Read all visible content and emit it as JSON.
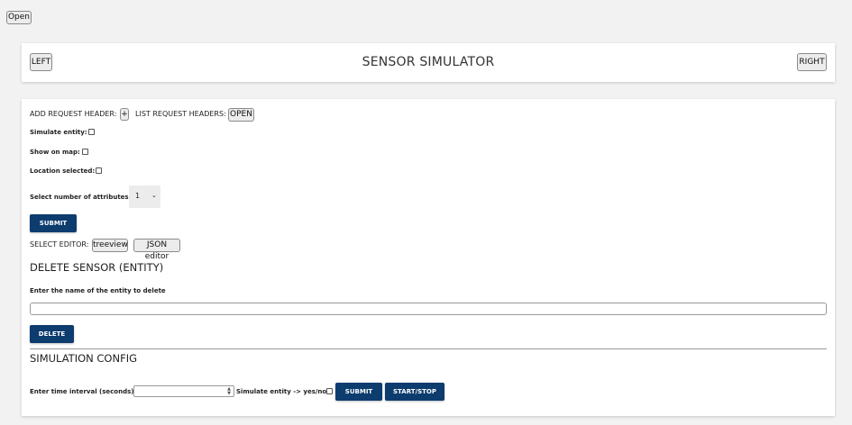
{
  "top": {
    "open_label": "Open"
  },
  "header": {
    "left_label": "LEFT",
    "title": "SENSOR SIMULATOR",
    "right_label": "RIGHT"
  },
  "request_headers": {
    "add_label": "ADD REQUEST HEADER:",
    "add_button": "+",
    "list_label": "LIST REQUEST HEADERS:",
    "list_button": "OPEN"
  },
  "options": {
    "simulate_entity": "Simulate entity:",
    "show_on_map": "Show on map:",
    "location_selected": "Location selected:",
    "attributes_label": "Select number of attributes",
    "attributes_value": "1",
    "submit_label": "SUBMIT"
  },
  "editor": {
    "label": "SELECT EDITOR:",
    "treeview": "treeview",
    "json_editor": "JSON editor"
  },
  "delete": {
    "heading": "DELETE SENSOR (ENTITY)",
    "field_label": "Enter the name of the entity to delete",
    "input_value": "",
    "button": "DELETE"
  },
  "simulation": {
    "heading": "SIMULATION CONFIG",
    "interval_label": "Enter time interval (seconds)",
    "interval_value": "",
    "simulate_label": "Simulate entity -> yes/no",
    "submit_label": "SUBMIT",
    "start_stop_label": "START/STOP"
  },
  "colors": {
    "primary": "#0d3c6e",
    "background": "#f2f2f2",
    "card": "#ffffff"
  }
}
